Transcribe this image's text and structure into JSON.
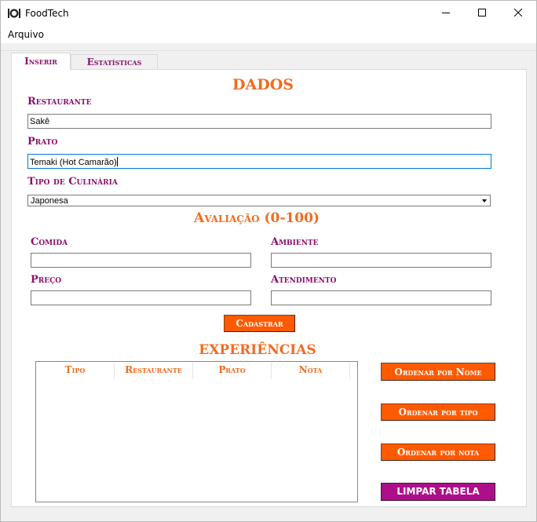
{
  "window": {
    "title": "FoodTech"
  },
  "menu": {
    "items": [
      "Arquivo"
    ]
  },
  "tabs": [
    {
      "label": "Inserir",
      "active": true
    },
    {
      "label": "Estatísticas",
      "active": false
    }
  ],
  "form": {
    "heading": "DADOS",
    "restaurante_label": "Restaurante",
    "restaurante_value": "Sakê",
    "prato_label": "Prato",
    "prato_value": "Temaki (Hot Camarão)",
    "tipo_label": "Tipo de Culinária",
    "tipo_value": "Japonesa"
  },
  "avaliacao": {
    "heading": "Avaliação (0-100)",
    "comida_label": "Comida",
    "comida_value": "",
    "ambiente_label": "Ambiente",
    "ambiente_value": "",
    "preco_label": "Preço",
    "preco_value": "",
    "atendimento_label": "Atendimento",
    "atendimento_value": "",
    "cadastrar_label": "Cadastrar"
  },
  "experiencias": {
    "heading": "EXPERIÊNCIAS",
    "columns": [
      "Tipo",
      "Restaurante",
      "Prato",
      "Nota"
    ],
    "rows": []
  },
  "actions": {
    "ordenar_nome": "Ordenar por Nome",
    "ordenar_tipo": "Ordenar por tipo",
    "ordenar_nota": "Ordenar por nota",
    "limpar": "LIMPAR TABELA"
  },
  "colors": {
    "accent_orange": "#f26b1d",
    "button_orange": "#ff5a00",
    "label_purple": "#8b0f6d",
    "button_purple": "#ad0f8a"
  }
}
